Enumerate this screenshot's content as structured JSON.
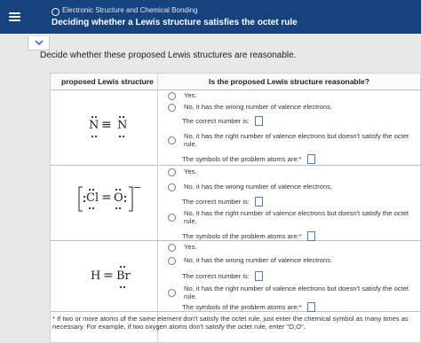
{
  "header": {
    "breadcrumb": "Electronic Structure and Chemical Bonding",
    "title": "Deciding whether a Lewis structure satisfies the octet rule"
  },
  "prompt": "Decide whether these proposed Lewis structures are reasonable.",
  "table": {
    "col1": "proposed Lewis structure",
    "col2": "Is the proposed Lewis structure reasonable?"
  },
  "rows": [
    {
      "structure": {
        "left": "N",
        "bond": "≡",
        "right": "N"
      },
      "options": {
        "yes": "Yes.",
        "wrong_count": "No, it has the wrong number of valence electrons.",
        "correct_number": "The correct number is:",
        "not_octet": "No, it has the right number of valence electrons but doesn't satisfy the octet rule.",
        "symbols": "The symbols of the problem atoms are:*"
      }
    },
    {
      "structure": {
        "left": "Cl",
        "bond": "=",
        "right": "O",
        "charge": "−"
      },
      "options": {
        "yes": "Yes.",
        "wrong_count": "No, it has the wrong number of valence electrons.",
        "correct_number": "The correct number is:",
        "not_octet": "No, it has the right number of valence electrons but doesn't satisfy the octet rule.",
        "symbols": "The symbols of the problem atoms are:*"
      }
    },
    {
      "structure": {
        "left": "H",
        "bond": "=",
        "right": "Br"
      },
      "options": {
        "yes": "Yes.",
        "wrong_count": "No, it has the wrong number of valence electrons.",
        "correct_number": "The correct number is:",
        "not_octet": "No, it has the right number of valence electrons but doesn't satisfy the octet rule.",
        "symbols": "The symbols of the problem atoms are:*"
      }
    }
  ],
  "footnote": "* If two or more atoms of the same element don't satisfy the octet rule, just enter the chemical symbol as many times as necessary. For example, if two oxygen atoms don't satisfy the octet rule, enter \"O,O\".",
  "colors": {
    "topbar": "#16437e",
    "input_border": "#4a7bd1"
  }
}
